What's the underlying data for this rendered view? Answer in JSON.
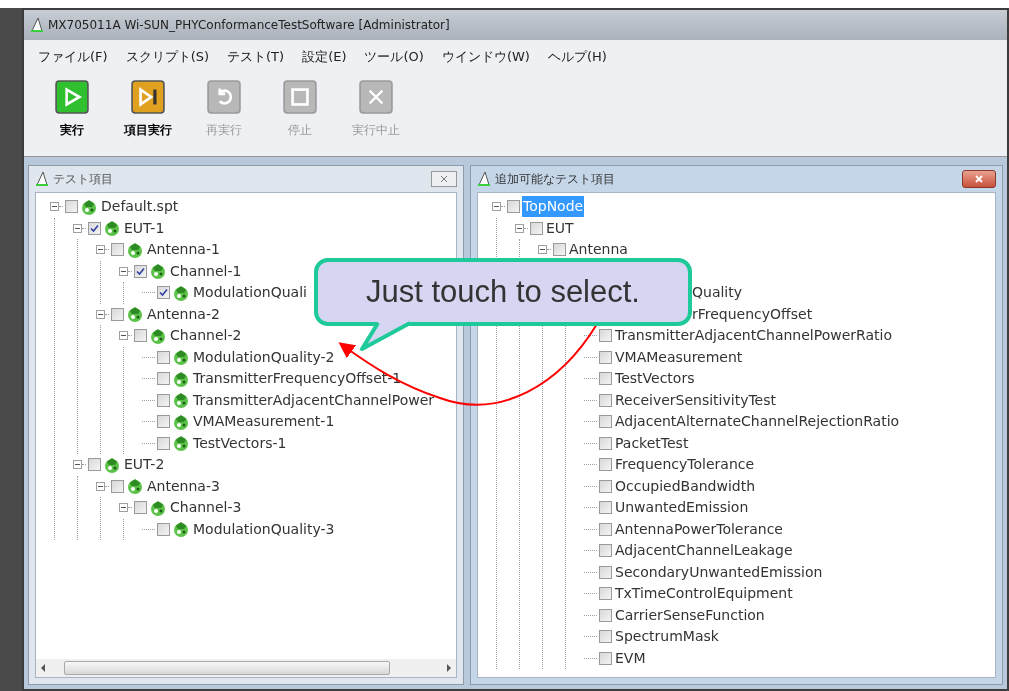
{
  "window": {
    "title": "MX705011A Wi-SUN_PHYConformanceTestSoftware [Administrator]"
  },
  "menu": [
    "ファイル(F)",
    "スクリプト(S)",
    "テスト(T)",
    "設定(E)",
    "ツール(O)",
    "ウインドウ(W)",
    "ヘルプ(H)"
  ],
  "toolbar": [
    {
      "label": "実行",
      "kind": "run",
      "disabled": false
    },
    {
      "label": "項目実行",
      "kind": "run-item",
      "disabled": false
    },
    {
      "label": "再実行",
      "kind": "rerun",
      "disabled": true
    },
    {
      "label": "停止",
      "kind": "stop",
      "disabled": true
    },
    {
      "label": "実行中止",
      "kind": "abort",
      "disabled": true
    }
  ],
  "left_panel": {
    "title": "テスト項目",
    "tree": [
      {
        "label": "Default.spt",
        "checked": false,
        "expanded": true,
        "children": [
          {
            "label": "EUT-1",
            "checked": true,
            "expanded": true,
            "children": [
              {
                "label": "Antenna-1",
                "checked": false,
                "expanded": true,
                "children": [
                  {
                    "label": "Channel-1",
                    "checked": true,
                    "expanded": true,
                    "children": [
                      {
                        "label": "ModulationQuali",
                        "checked": true
                      }
                    ]
                  }
                ]
              },
              {
                "label": "Antenna-2",
                "checked": false,
                "expanded": true,
                "children": [
                  {
                    "label": "Channel-2",
                    "checked": false,
                    "expanded": true,
                    "children": [
                      {
                        "label": "ModulationQuality-2",
                        "checked": false
                      },
                      {
                        "label": "TransmitterFrequencyOffset-1",
                        "checked": false
                      },
                      {
                        "label": "TransmitterAdjacentChannelPower",
                        "checked": false
                      },
                      {
                        "label": "VMAMeasurement-1",
                        "checked": false
                      },
                      {
                        "label": "TestVectors-1",
                        "checked": false
                      }
                    ]
                  }
                ]
              }
            ]
          },
          {
            "label": "EUT-2",
            "checked": false,
            "expanded": true,
            "children": [
              {
                "label": "Antenna-3",
                "checked": false,
                "expanded": true,
                "children": [
                  {
                    "label": "Channel-3",
                    "checked": false,
                    "expanded": true,
                    "children": [
                      {
                        "label": "ModulationQuality-3",
                        "checked": false
                      }
                    ]
                  }
                ]
              }
            ]
          }
        ]
      }
    ]
  },
  "right_panel": {
    "title": "追加可能なテスト項目",
    "tree": [
      {
        "label": "TopNode",
        "checked": false,
        "expanded": true,
        "selected": true,
        "children": [
          {
            "label": "EUT",
            "checked": false,
            "expanded": true,
            "selected": false,
            "children": [
              {
                "label": "Antenna",
                "checked": false,
                "expanded": true,
                "selected": false,
                "children": [
                  {
                    "children": [
                      {
                        "kind": "partial",
                        "label": "Quality"
                      },
                      {
                        "kind": "partial",
                        "label": "rFrequencyOffset"
                      },
                      {
                        "label": "TransmitterAdjacentChannelPowerRatio",
                        "checked": false,
                        "selected": false
                      },
                      {
                        "label": "VMAMeasurement",
                        "checked": false,
                        "selected": false
                      },
                      {
                        "label": "TestVectors",
                        "checked": false,
                        "selected": false
                      },
                      {
                        "label": "ReceiverSensitivityTest",
                        "checked": false,
                        "selected": false
                      },
                      {
                        "label": "AdjacentAlternateChannelRejectionRatio",
                        "checked": false,
                        "selected": false
                      },
                      {
                        "label": "PacketTest",
                        "checked": false,
                        "selected": false
                      },
                      {
                        "label": "FrequencyTolerance",
                        "checked": false,
                        "selected": false
                      },
                      {
                        "label": "OccupiedBandwidth",
                        "checked": false,
                        "selected": false
                      },
                      {
                        "label": "UnwantedEmission",
                        "checked": false,
                        "selected": false
                      },
                      {
                        "label": "AntennaPowerTolerance",
                        "checked": false,
                        "selected": false
                      },
                      {
                        "label": "AdjacentChannelLeakage",
                        "checked": false,
                        "selected": false
                      },
                      {
                        "label": "SecondaryUnwantedEmission",
                        "checked": false,
                        "selected": false
                      },
                      {
                        "label": "TxTimeControlEquipment",
                        "checked": false,
                        "selected": false
                      },
                      {
                        "label": "CarrierSenseFunction",
                        "checked": false,
                        "selected": false
                      },
                      {
                        "label": "SpectrumMask",
                        "checked": false,
                        "selected": false
                      },
                      {
                        "label": "EVM",
                        "checked": false,
                        "selected": false
                      }
                    ]
                  }
                ]
              }
            ]
          }
        ]
      }
    ]
  },
  "callout": {
    "text": "Just touch to select."
  }
}
